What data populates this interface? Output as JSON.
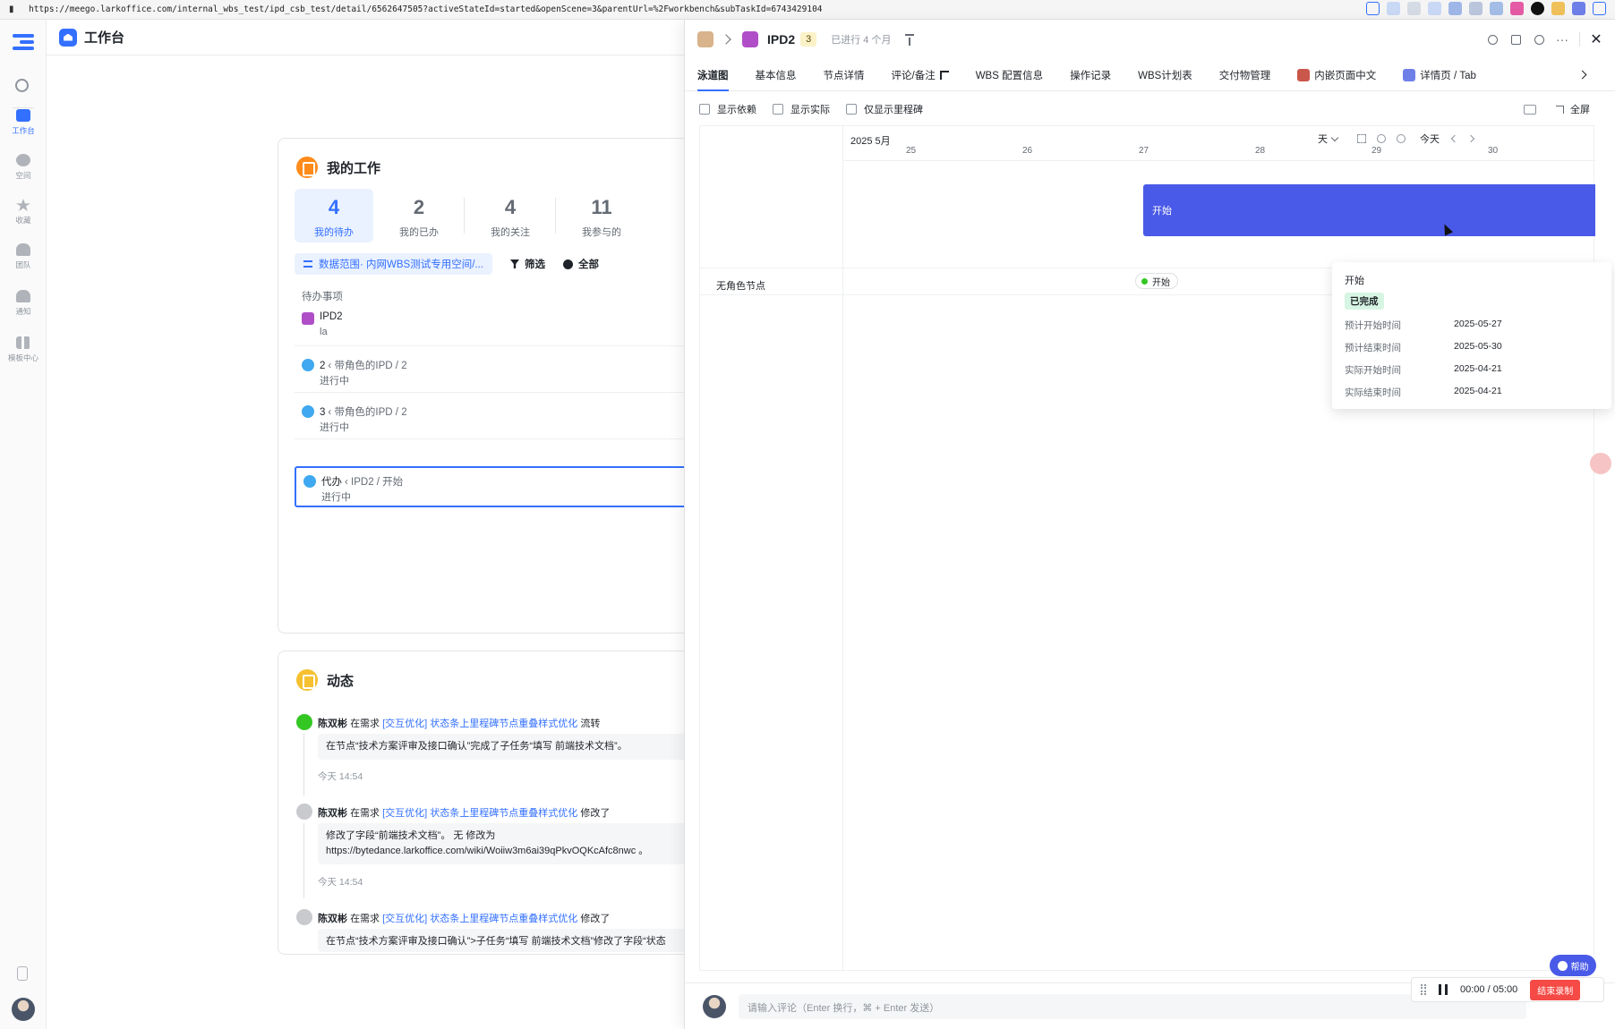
{
  "browser": {
    "url": "https://meego.larkoffice.com/internal_wbs_test/ipd_csb_test/detail/6562647505?activeStateId=started&openScene=3&parentUrl=%2Fworkbench&subTaskId=6743429104"
  },
  "rail": {
    "items": [
      {
        "label": "工作台",
        "icon": "home-icon",
        "active": true
      },
      {
        "label": "空间",
        "icon": "space-icon"
      },
      {
        "label": "收藏",
        "icon": "star-icon"
      },
      {
        "label": "团队",
        "icon": "team-icon"
      },
      {
        "label": "通知",
        "icon": "bell-icon"
      },
      {
        "label": "模板中心",
        "icon": "template-icon"
      }
    ]
  },
  "workbench": {
    "title": "工作台",
    "my_work": {
      "title": "我的工作",
      "stats": [
        {
          "num": "4",
          "label": "我的待办"
        },
        {
          "num": "2",
          "label": "我的已办"
        },
        {
          "num": "4",
          "label": "我的关注"
        },
        {
          "num": "11",
          "label": "我参与的"
        }
      ],
      "scope": "数据范围· 内网WBS测试专用空间/...",
      "filter": "筛选",
      "all": "全部",
      "todo_header": "待办事项",
      "todos": [
        {
          "name": "IPD2",
          "path": "",
          "sub": "la"
        },
        {
          "name": "2",
          "path": "带角色的IPD / 2",
          "sub": "进行中"
        },
        {
          "name": "3",
          "path": "带角色的IPD / 2",
          "sub": "进行中"
        },
        {
          "name": "代办",
          "path": "IPD2 / 开始",
          "sub": "进行中"
        }
      ]
    },
    "feed": {
      "title": "动态",
      "items": [
        {
          "user": "陈双彬",
          "in": "在需求",
          "link": "[交互优化] 状态条上里程碑节点重叠样式优化",
          "action": "流转",
          "detail": "在节点“技术方案评审及接口确认”完成了子任务“填写 前端技术文档”。",
          "time": "今天 14:54"
        },
        {
          "user": "陈双彬",
          "in": "在需求",
          "link": "[交互优化] 状态条上里程碑节点重叠样式优化",
          "action": "修改了",
          "detail": "修改了字段“前端技术文档”。 无 修改为 https://bytedance.larkoffice.com/wiki/Woiiw3m6ai39qPkvOQKcAfc8nwc 。",
          "time": "今天 14:54"
        },
        {
          "user": "陈双彬",
          "in": "在需求",
          "link": "[交互优化] 状态条上里程碑节点重叠样式优化",
          "action": "修改了",
          "detail": "在节点“技术方案评审及接口确认”>子任务“填写 前端技术文档”修改了字段“状态",
          "time": ""
        }
      ]
    }
  },
  "panel": {
    "name": "IPD2",
    "count": "3",
    "since": "已进行 4 个月",
    "tabs": [
      {
        "label": "泳道图",
        "active": true
      },
      {
        "label": "基本信息"
      },
      {
        "label": "节点详情"
      },
      {
        "label": "评论/备注"
      },
      {
        "label": "WBS 配置信息"
      },
      {
        "label": "操作记录"
      },
      {
        "label": "WBS计划表"
      },
      {
        "label": "交付物管理"
      },
      {
        "label": "内嵌页面中文"
      },
      {
        "label": "详情页 / Tab"
      }
    ],
    "options": {
      "show_deps": "显示依赖",
      "show_actual": "显示实际",
      "milestone_only": "仅显示里程碑",
      "fullscreen": "全屏"
    },
    "gantt": {
      "month": "2025 5月",
      "scale": "天",
      "today": "今天",
      "days": [
        "25",
        "26",
        "27",
        "28",
        "29",
        "30"
      ],
      "bar_label": "开始",
      "row_label": "无角色节点",
      "chip_label": "开始",
      "tooltip": {
        "title": "开始",
        "badge": "已完成",
        "rows": [
          {
            "k": "预计开始时间",
            "v": "2025-05-27"
          },
          {
            "k": "预计结束时间",
            "v": "2025-05-30"
          },
          {
            "k": "实际开始时间",
            "v": "2025-04-21"
          },
          {
            "k": "实际结束时间",
            "v": "2025-04-21"
          }
        ]
      }
    },
    "comment_placeholder": "请输入评论（Enter 换行，⌘ + Enter 发送）"
  },
  "help": "帮助",
  "recorder": {
    "time": "00:00 / 05:00",
    "stop": "结束录制"
  },
  "colors": {
    "accent": "#3370ff",
    "bar": "#4a5ae8",
    "ipd": "#b04ec8",
    "done_badge": "#d7f5e3"
  }
}
